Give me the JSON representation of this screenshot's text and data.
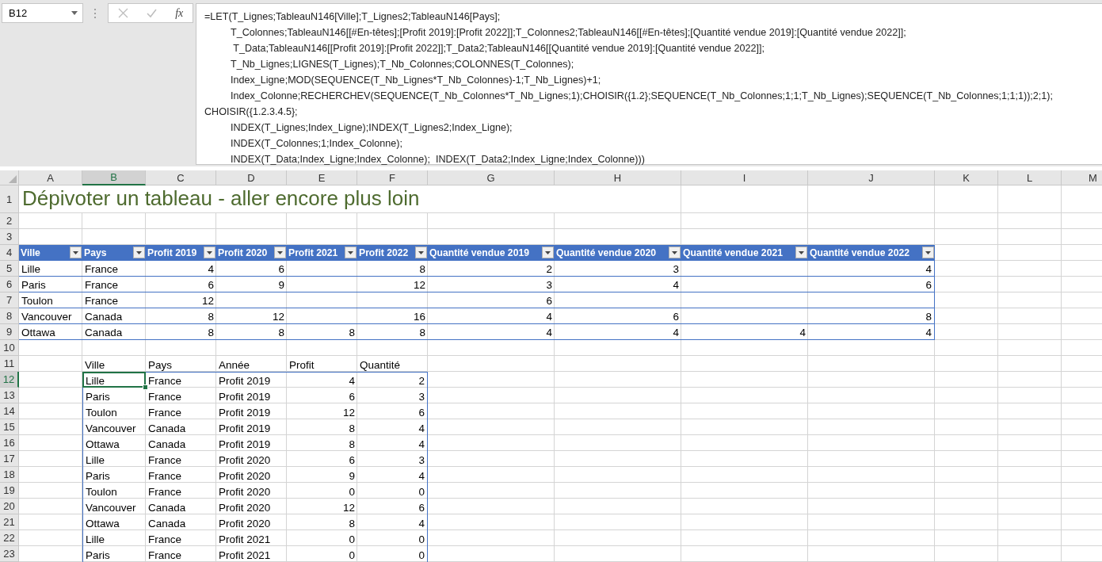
{
  "name_box": {
    "value": "B12"
  },
  "formula_bar": {
    "function_label": "fx",
    "lines": [
      {
        "text": "=LET(T_Lignes;TableauN146[Ville];T_Lignes2;TableauN146[Pays];",
        "indented": false
      },
      {
        "text": "T_Colonnes;TableauN146[[#En-têtes];[Profit 2019]:[Profit 2022]];T_Colonnes2;TableauN146[[#En-têtes];[Quantité vendue 2019]:[Quantité vendue 2022]];",
        "indented": true
      },
      {
        "text": " T_Data;TableauN146[[Profit 2019]:[Profit 2022]];T_Data2;TableauN146[[Quantité vendue 2019]:[Quantité vendue 2022]];",
        "indented": true
      },
      {
        "text": "T_Nb_Lignes;LIGNES(T_Lignes);T_Nb_Colonnes;COLONNES(T_Colonnes);",
        "indented": true
      },
      {
        "text": "Index_Ligne;MOD(SEQUENCE(T_Nb_Lignes*T_Nb_Colonnes)-1;T_Nb_Lignes)+1;",
        "indented": true
      },
      {
        "text": "Index_Colonne;RECHERCHEV(SEQUENCE(T_Nb_Colonnes*T_Nb_Lignes;1);CHOISIR({1.2};SEQUENCE(T_Nb_Colonnes;1;1;T_Nb_Lignes);SEQUENCE(T_Nb_Colonnes;1;1;1));2;1);",
        "indented": true
      },
      {
        "text": "CHOISIR({1.2.3.4.5};",
        "indented": false
      },
      {
        "text": "INDEX(T_Lignes;Index_Ligne);INDEX(T_Lignes2;Index_Ligne);",
        "indented": true
      },
      {
        "text": "INDEX(T_Colonnes;1;Index_Colonne);",
        "indented": true
      },
      {
        "text": "INDEX(T_Data;Index_Ligne;Index_Colonne);  INDEX(T_Data2;Index_Ligne;Index_Colonne)))",
        "indented": true
      }
    ]
  },
  "columns": [
    {
      "label": "A",
      "selected": false
    },
    {
      "label": "B",
      "selected": true
    },
    {
      "label": "C",
      "selected": false
    },
    {
      "label": "D",
      "selected": false
    },
    {
      "label": "E",
      "selected": false
    },
    {
      "label": "F",
      "selected": false
    },
    {
      "label": "G",
      "selected": false
    },
    {
      "label": "H",
      "selected": false
    },
    {
      "label": "I",
      "selected": false
    },
    {
      "label": "J",
      "selected": false
    },
    {
      "label": "K",
      "selected": false
    },
    {
      "label": "L",
      "selected": false
    },
    {
      "label": "M",
      "selected": false
    }
  ],
  "rows": [
    {
      "label": "1",
      "selected": false
    },
    {
      "label": "2",
      "selected": false
    },
    {
      "label": "3",
      "selected": false
    },
    {
      "label": "4",
      "selected": false
    },
    {
      "label": "5",
      "selected": false
    },
    {
      "label": "6",
      "selected": false
    },
    {
      "label": "7",
      "selected": false
    },
    {
      "label": "8",
      "selected": false
    },
    {
      "label": "9",
      "selected": false
    },
    {
      "label": "10",
      "selected": false
    },
    {
      "label": "11",
      "selected": false
    },
    {
      "label": "12",
      "selected": true
    },
    {
      "label": "13",
      "selected": false
    },
    {
      "label": "14",
      "selected": false
    },
    {
      "label": "15",
      "selected": false
    },
    {
      "label": "16",
      "selected": false
    },
    {
      "label": "17",
      "selected": false
    },
    {
      "label": "18",
      "selected": false
    },
    {
      "label": "19",
      "selected": false
    },
    {
      "label": "20",
      "selected": false
    },
    {
      "label": "21",
      "selected": false
    },
    {
      "label": "22",
      "selected": false
    },
    {
      "label": "23",
      "selected": false
    }
  ],
  "title": "Dépivoter un tableau - aller encore plus loin",
  "source_table": {
    "columns": [
      {
        "label": "Ville",
        "kind": "text"
      },
      {
        "label": "Pays",
        "kind": "text"
      },
      {
        "label": "Profit 2019",
        "kind": "number"
      },
      {
        "label": "Profit 2020",
        "kind": "number"
      },
      {
        "label": "Profit 2021",
        "kind": "number"
      },
      {
        "label": "Profit 2022",
        "kind": "number"
      },
      {
        "label": "Quantité vendue 2019",
        "kind": "number"
      },
      {
        "label": "Quantité vendue 2020",
        "kind": "number"
      },
      {
        "label": "Quantité vendue 2021",
        "kind": "number"
      },
      {
        "label": "Quantité vendue 2022",
        "kind": "number"
      }
    ],
    "rows": [
      [
        "Lille",
        "France",
        "4",
        "6",
        null,
        "8",
        "2",
        "3",
        null,
        "4"
      ],
      [
        "Paris",
        "France",
        "6",
        "9",
        null,
        "12",
        "3",
        "4",
        null,
        "6"
      ],
      [
        "Toulon",
        "France",
        "12",
        null,
        null,
        null,
        "6",
        null,
        null,
        null
      ],
      [
        "Vancouver",
        "Canada",
        "8",
        "12",
        null,
        "16",
        "4",
        "6",
        null,
        "8"
      ],
      [
        "Ottawa",
        "Canada",
        "8",
        "8",
        "8",
        "8",
        "4",
        "4",
        "4",
        "4"
      ]
    ]
  },
  "result_table": {
    "columns": [
      {
        "label": "Ville",
        "kind": "text"
      },
      {
        "label": "Pays",
        "kind": "text"
      },
      {
        "label": "Année",
        "kind": "text"
      },
      {
        "label": "Profit",
        "kind": "number"
      },
      {
        "label": "Quantité",
        "kind": "number"
      }
    ],
    "rows": [
      [
        "Lille",
        "France",
        "Profit 2019",
        "4",
        "2"
      ],
      [
        "Paris",
        "France",
        "Profit 2019",
        "6",
        "3"
      ],
      [
        "Toulon",
        "France",
        "Profit 2019",
        "12",
        "6"
      ],
      [
        "Vancouver",
        "Canada",
        "Profit 2019",
        "8",
        "4"
      ],
      [
        "Ottawa",
        "Canada",
        "Profit 2019",
        "8",
        "4"
      ],
      [
        "Lille",
        "France",
        "Profit 2020",
        "6",
        "3"
      ],
      [
        "Paris",
        "France",
        "Profit 2020",
        "9",
        "4"
      ],
      [
        "Toulon",
        "France",
        "Profit 2020",
        "0",
        "0"
      ],
      [
        "Vancouver",
        "Canada",
        "Profit 2020",
        "12",
        "6"
      ],
      [
        "Ottawa",
        "Canada",
        "Profit 2020",
        "8",
        "4"
      ],
      [
        "Lille",
        "France",
        "Profit 2021",
        "0",
        "0"
      ],
      [
        "Paris",
        "France",
        "Profit 2021",
        "0",
        "0"
      ]
    ]
  }
}
